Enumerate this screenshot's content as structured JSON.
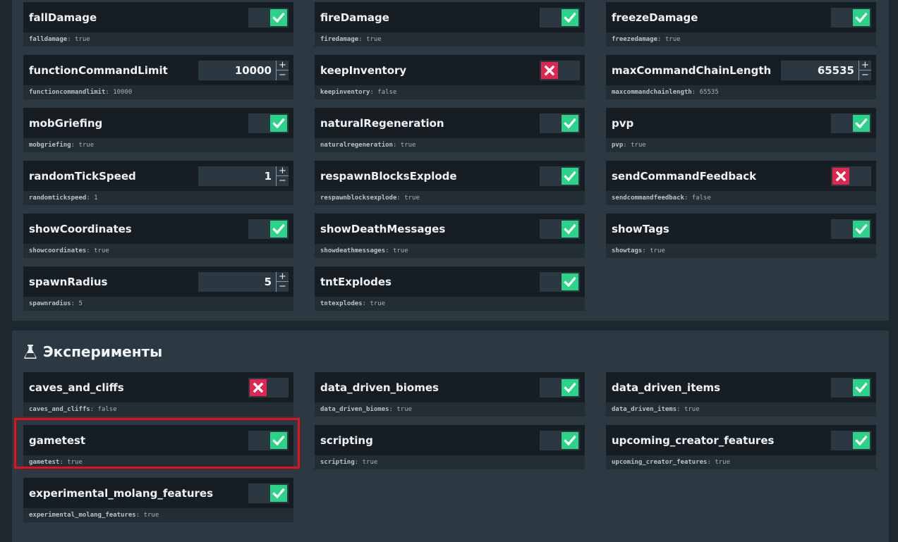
{
  "colors": {
    "page_bg": "#1d272e",
    "panel_bg": "#2c3942",
    "row_bg": "#161e24",
    "desc_bg": "#222d34",
    "toggle_on": "#2bd389",
    "toggle_off": "#e0264f",
    "highlight": "#e5121b"
  },
  "gamerules": [
    {
      "name": "fallDamage",
      "key": "falldamage",
      "type": "toggle",
      "value": "true"
    },
    {
      "name": "fireDamage",
      "key": "firedamage",
      "type": "toggle",
      "value": "true"
    },
    {
      "name": "freezeDamage",
      "key": "freezedamage",
      "type": "toggle",
      "value": "true"
    },
    {
      "name": "functionCommandLimit",
      "key": "functioncommandlimit",
      "type": "number",
      "value": "10000"
    },
    {
      "name": "keepInventory",
      "key": "keepinventory",
      "type": "toggle",
      "value": "false"
    },
    {
      "name": "maxCommandChainLength",
      "key": "maxcommandchainlength",
      "type": "number",
      "value": "65535"
    },
    {
      "name": "mobGriefing",
      "key": "mobgriefing",
      "type": "toggle",
      "value": "true"
    },
    {
      "name": "naturalRegeneration",
      "key": "naturalregeneration",
      "type": "toggle",
      "value": "true"
    },
    {
      "name": "pvp",
      "key": "pvp",
      "type": "toggle",
      "value": "true"
    },
    {
      "name": "randomTickSpeed",
      "key": "randomtickspeed",
      "type": "number",
      "value": "1"
    },
    {
      "name": "respawnBlocksExplode",
      "key": "respawnblocksexplode",
      "type": "toggle",
      "value": "true"
    },
    {
      "name": "sendCommandFeedback",
      "key": "sendcommandfeedback",
      "type": "toggle",
      "value": "false"
    },
    {
      "name": "showCoordinates",
      "key": "showcoordinates",
      "type": "toggle",
      "value": "true"
    },
    {
      "name": "showDeathMessages",
      "key": "showdeathmessages",
      "type": "toggle",
      "value": "true"
    },
    {
      "name": "showTags",
      "key": "showtags",
      "type": "toggle",
      "value": "true"
    },
    {
      "name": "spawnRadius",
      "key": "spawnradius",
      "type": "number",
      "value": "5"
    },
    {
      "name": "tntExplodes",
      "key": "tntexplodes",
      "type": "toggle",
      "value": "true"
    }
  ],
  "experiments": {
    "title": "Эксперименты",
    "icon": "flask-icon",
    "items": [
      {
        "name": "caves_and_cliffs",
        "key": "caves_and_cliffs",
        "type": "toggle",
        "value": "false"
      },
      {
        "name": "data_driven_biomes",
        "key": "data_driven_biomes",
        "type": "toggle",
        "value": "true"
      },
      {
        "name": "data_driven_items",
        "key": "data_driven_items",
        "type": "toggle",
        "value": "true"
      },
      {
        "name": "gametest",
        "key": "gametest",
        "type": "toggle",
        "value": "true",
        "highlighted": true
      },
      {
        "name": "scripting",
        "key": "scripting",
        "type": "toggle",
        "value": "true"
      },
      {
        "name": "upcoming_creator_features",
        "key": "upcoming_creator_features",
        "type": "toggle",
        "value": "true"
      },
      {
        "name": "experimental_molang_features",
        "key": "experimental_molang_features",
        "type": "toggle",
        "value": "true"
      }
    ]
  },
  "stepper": {
    "plus": "+",
    "minus": "−"
  }
}
